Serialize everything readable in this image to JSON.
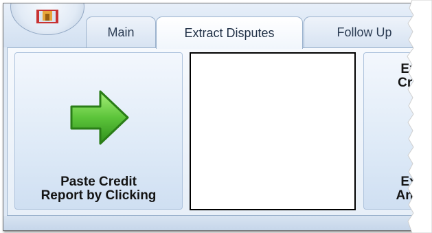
{
  "tabs": {
    "main": "Main",
    "extract_disputes": "Extract Disputes",
    "follow_up": "Follow Up"
  },
  "ribbon": {
    "paste_button_label": "Paste Credit\nReport by Clicking",
    "extract_button_label_top": "Ex\nCre",
    "extract_button_label_bottom": "Ex\nAnn"
  },
  "icons": {
    "app": "app-logo-icon",
    "paste": "green-right-arrow-icon"
  },
  "colors": {
    "arrow_green": "#5cc43a",
    "tab_border": "#9bb2cd",
    "ribbon_bg": "#dde8f5"
  }
}
